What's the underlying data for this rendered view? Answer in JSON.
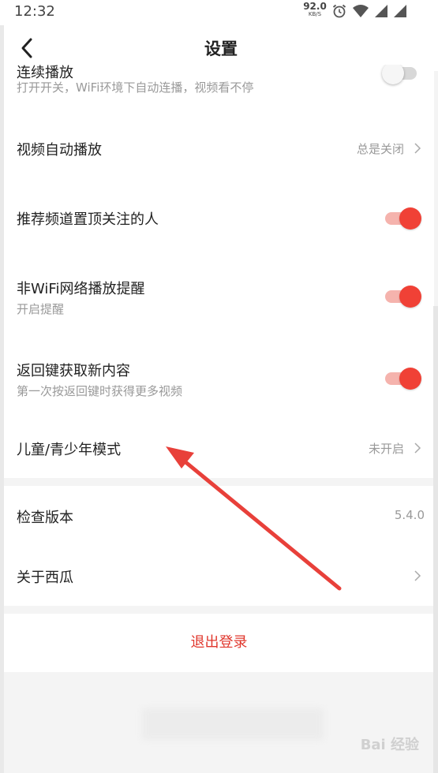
{
  "status_bar": {
    "time": "12:32",
    "net_speed_value": "92.0",
    "net_speed_unit": "KB/S",
    "icons": [
      "alarm-icon",
      "wifi-icon",
      "signal-icon",
      "signal-icon"
    ]
  },
  "nav": {
    "title": "设置",
    "back_icon": "chevron-left-icon"
  },
  "settings": {
    "autoplay_continuous": {
      "title": "连续播放",
      "subtitle": "打开开关，WiFi环境下自动连播，视频看不停",
      "enabled": false
    },
    "video_autoplay": {
      "title": "视频自动播放",
      "value": "总是关闭"
    },
    "recommend_channel": {
      "title": "推荐频道置顶关注的人",
      "enabled": true
    },
    "non_wifi_reminder": {
      "title": "非WiFi网络播放提醒",
      "subtitle": "开启提醒",
      "enabled": true
    },
    "back_key_refresh": {
      "title": "返回键获取新内容",
      "subtitle": "第一次按返回键时获得更多视频",
      "enabled": true
    },
    "kids_mode": {
      "title": "儿童/青少年模式",
      "value": "未开启"
    }
  },
  "about": {
    "check_version": {
      "title": "检查版本",
      "value": "5.4.0"
    },
    "about_xigua": {
      "title": "关于西瓜"
    }
  },
  "logout_label": "退出登录",
  "watermark": "Bai 经验",
  "colors": {
    "accent": "#f04136",
    "logout": "#e0372d",
    "secondary_text": "#999999"
  }
}
